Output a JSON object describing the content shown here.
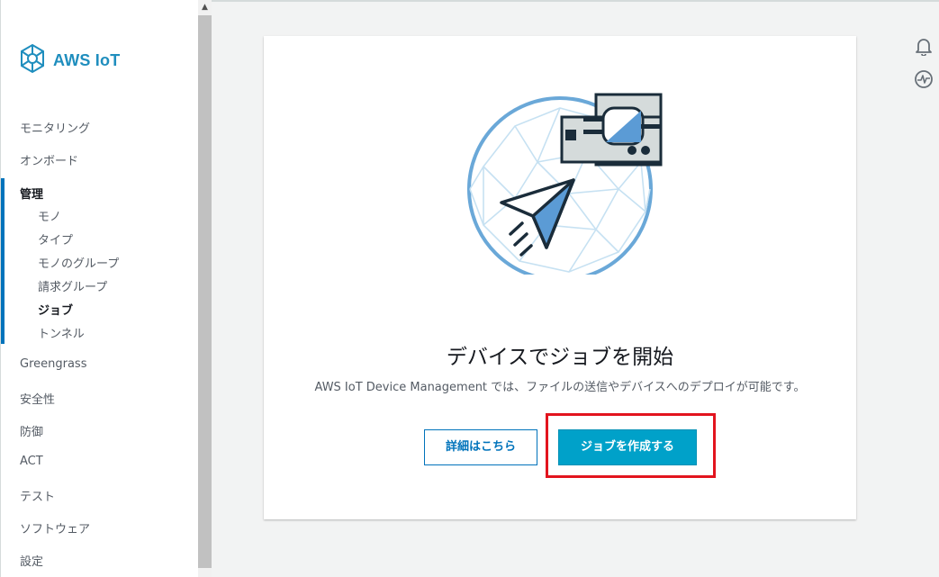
{
  "sidebar": {
    "logo_text": "AWS IoT",
    "items": [
      {
        "label": "モニタリング"
      },
      {
        "label": "オンボード"
      },
      {
        "label": "管理"
      },
      {
        "label": "Greengrass"
      },
      {
        "label": "安全性"
      },
      {
        "label": "防御"
      },
      {
        "label": "ACT"
      },
      {
        "label": "テスト"
      },
      {
        "label": "ソフトウェア"
      },
      {
        "label": "設定"
      }
    ],
    "sub_items": [
      {
        "label": "モノ"
      },
      {
        "label": "タイプ"
      },
      {
        "label": "モノのグループ"
      },
      {
        "label": "請求グループ"
      },
      {
        "label": "ジョブ"
      },
      {
        "label": "トンネル"
      }
    ]
  },
  "icons": {
    "notifications": "bell-icon",
    "health": "activity-icon",
    "logo": "aws-iot-logo-icon",
    "scroll": "chevron-up-icon"
  },
  "main": {
    "title": "デバイスでジョブを開始",
    "description": "AWS IoT Device Management では、ファイルの送信やデバイスへのデプロイが可能です。",
    "learn_more_label": "詳細はこちら",
    "create_job_label": "ジョブを作成する"
  },
  "colors": {
    "accent": "#1f8ebe",
    "primary_button": "#00a1c9",
    "highlight": "#e2141e"
  }
}
